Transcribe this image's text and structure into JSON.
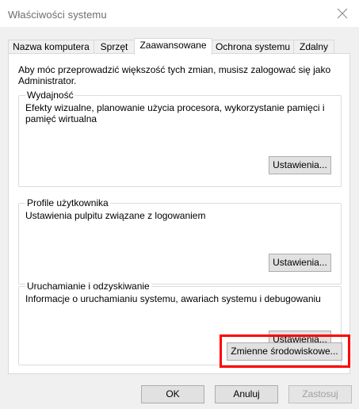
{
  "window": {
    "title": "Właściwości systemu",
    "close_icon": "close-icon"
  },
  "tabs": [
    {
      "label": "Nazwa komputera",
      "active": false
    },
    {
      "label": "Sprzęt",
      "active": false
    },
    {
      "label": "Zaawansowane",
      "active": true
    },
    {
      "label": "Ochrona systemu",
      "active": false
    },
    {
      "label": "Zdalny",
      "active": false
    }
  ],
  "intro_text": "Aby móc przeprowadzić większość tych zmian, musisz zalogować się jako Administrator.",
  "groups": {
    "performance": {
      "title": "Wydajność",
      "description": "Efekty wizualne, planowanie użycia procesora, wykorzystanie pamięci i pamięć wirtualna",
      "button": "Ustawienia..."
    },
    "profiles": {
      "title": "Profile użytkownika",
      "description": "Ustawienia pulpitu związane z logowaniem",
      "button": "Ustawienia..."
    },
    "startup": {
      "title": "Uruchamianie i odzyskiwanie",
      "description": "Informacje o uruchamianiu systemu, awariach systemu i debugowaniu",
      "button": "Ustawienia..."
    }
  },
  "env_button": "Zmienne środowiskowe...",
  "footer": {
    "ok": "OK",
    "cancel": "Anuluj",
    "apply": "Zastosuj"
  },
  "colors": {
    "highlight": "#ff0000",
    "accent": "#0078d7",
    "dialog_bg": "#f0f0f0"
  }
}
